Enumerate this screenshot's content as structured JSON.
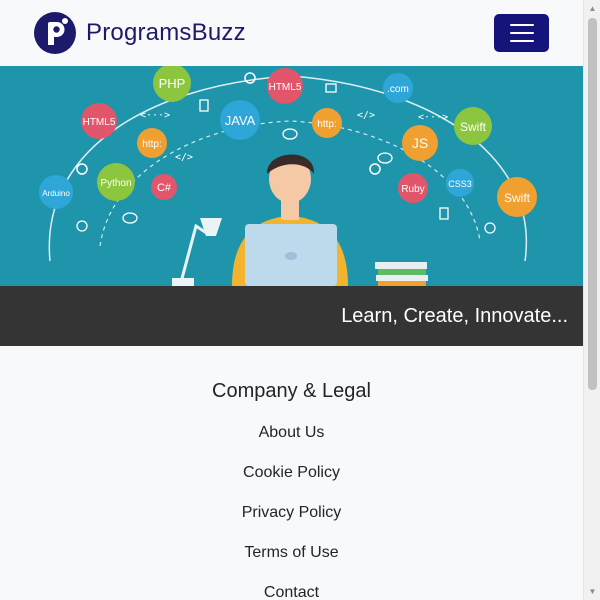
{
  "brand": {
    "name": "ProgramsBuzz"
  },
  "navbar": {
    "toggle_icon": "hamburger-icon"
  },
  "banner": {
    "bubbles": [
      {
        "text": "PHP",
        "color": "#8cc63f"
      },
      {
        "text": "HTML5",
        "color": "#e2566b"
      },
      {
        "text": ".com",
        "color": "#2fa6d8"
      },
      {
        "text": "HTML5",
        "color": "#e2566b"
      },
      {
        "text": "JAVA",
        "color": "#2fa6d8"
      },
      {
        "text": "http:",
        "color": "#f0a030"
      },
      {
        "text": "http:",
        "color": "#f0a030"
      },
      {
        "text": "JS",
        "color": "#f0a030"
      },
      {
        "text": "Swift",
        "color": "#8cc63f"
      },
      {
        "text": "Python",
        "color": "#8cc63f"
      },
      {
        "text": "C#",
        "color": "#e2566b"
      },
      {
        "text": "Arduino",
        "color": "#2fa6d8"
      },
      {
        "text": "Ruby",
        "color": "#e2566b"
      },
      {
        "text": "CSS3",
        "color": "#2fa6d8"
      },
      {
        "text": "Swift",
        "color": "#f0a030"
      }
    ]
  },
  "tagline": "Learn, Create, Innovate...",
  "footer": {
    "title": "Company & Legal",
    "links": [
      "About Us",
      "Cookie Policy",
      "Privacy Policy",
      "Terms of Use",
      "Contact"
    ]
  },
  "colors": {
    "brand": "#1c1a6b",
    "toggler": "#14147a",
    "banner": "#1f95ab",
    "tagline_bar": "#343434"
  }
}
